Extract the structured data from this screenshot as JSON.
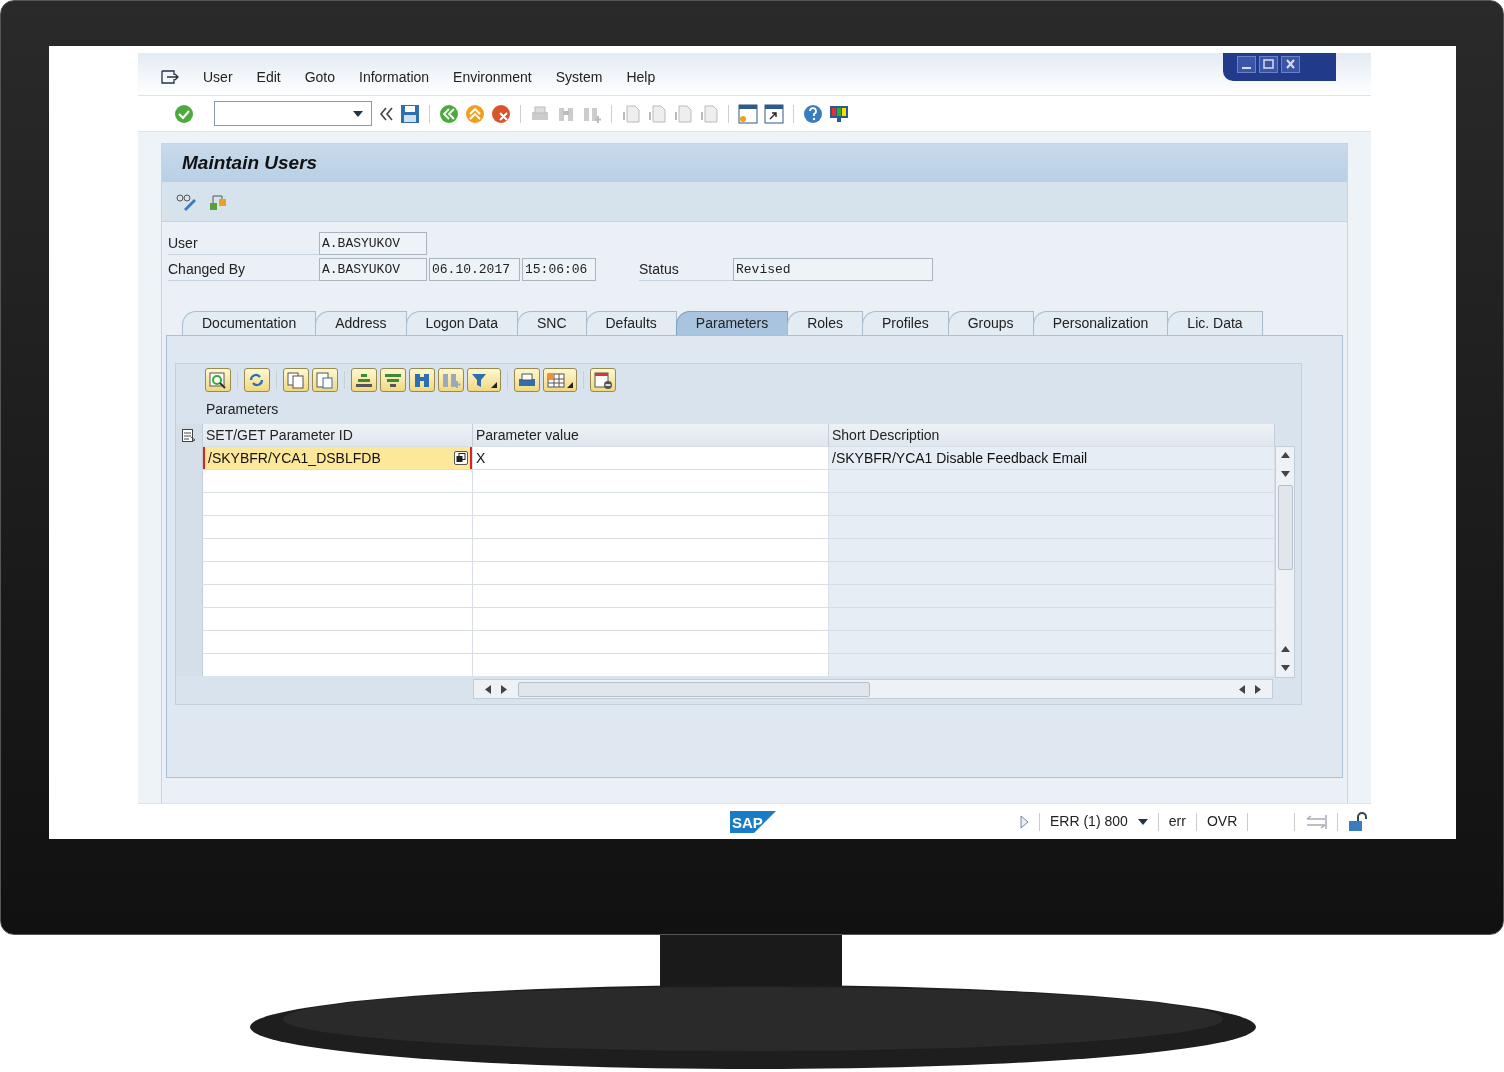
{
  "menu": [
    {
      "label": "User"
    },
    {
      "label": "Edit"
    },
    {
      "label": "Goto"
    },
    {
      "label": "Information"
    },
    {
      "label": "Environment"
    },
    {
      "label": "System"
    },
    {
      "label": "Help"
    }
  ],
  "title": "Maintain Users",
  "fields": [
    {
      "label": "User",
      "values": [
        "A.BASYUKOV"
      ]
    },
    {
      "label": "Changed By",
      "values": [
        "A.BASYUKOV",
        "06.10.2017",
        "15:06:06"
      ]
    }
  ],
  "status_field": {
    "label": "Status",
    "value": "Revised"
  },
  "tabs": [
    {
      "label": "Documentation",
      "selected": false
    },
    {
      "label": "Address",
      "selected": false
    },
    {
      "label": "Logon Data",
      "selected": false
    },
    {
      "label": "SNC",
      "selected": false
    },
    {
      "label": "Defaults",
      "selected": false
    },
    {
      "label": "Parameters",
      "selected": true
    },
    {
      "label": "Roles",
      "selected": false
    },
    {
      "label": "Profiles",
      "selected": false
    },
    {
      "label": "Groups",
      "selected": false
    },
    {
      "label": "Personalization",
      "selected": false
    },
    {
      "label": "Lic. Data",
      "selected": false
    }
  ],
  "table": {
    "title": "Parameters",
    "columns": [
      "SET/GET Parameter ID",
      "Parameter value",
      "Short Description"
    ],
    "rows": [
      {
        "cells": [
          "/SKYBFR/YCA1_DSBLFDB",
          "X",
          "/SKYBFR/YCA1 Disable Feedback Email"
        ],
        "focused": true
      }
    ]
  },
  "status_bar": {
    "logo": "SAP",
    "system": "ERR (1) 800",
    "client": "err",
    "mode": "OVR"
  }
}
